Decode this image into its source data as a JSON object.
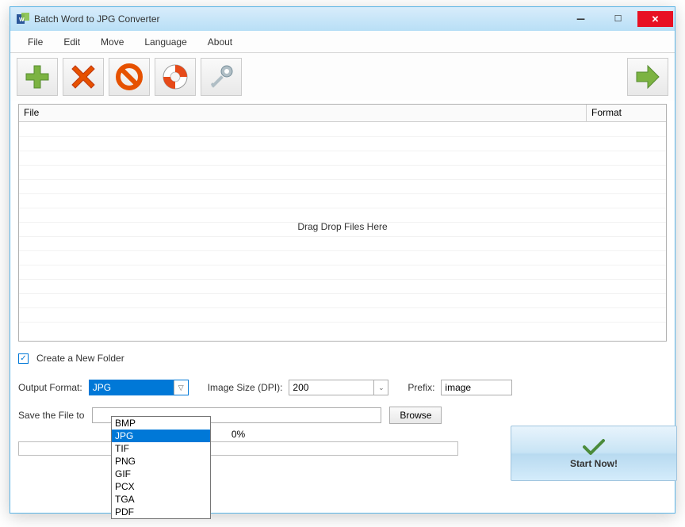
{
  "title": "Batch Word to JPG Converter",
  "menu": {
    "file": "File",
    "edit": "Edit",
    "move": "Move",
    "language": "Language",
    "about": "About"
  },
  "toolbar_icons": {
    "add": "add-icon",
    "remove": "remove-icon",
    "clear": "clear-icon",
    "help": "help-icon",
    "register": "register-icon",
    "convert": "convert-icon"
  },
  "table": {
    "col_file": "File",
    "col_format": "Format",
    "drag_hint": "Drag  Drop Files Here"
  },
  "checkbox_label": "Create a New Folder",
  "checkbox_checked": true,
  "output_format": {
    "label": "Output Format:",
    "value": "JPG",
    "options": [
      "BMP",
      "JPG",
      "TIF",
      "PNG",
      "GIF",
      "PCX",
      "TGA",
      "PDF"
    ],
    "selected_index": 1
  },
  "image_size": {
    "label": "Image Size (DPI):",
    "value": "200"
  },
  "prefix": {
    "label": "Prefix:",
    "value": "image"
  },
  "save": {
    "label": "Save the File to",
    "value": "",
    "browse": "Browse"
  },
  "progress": {
    "percent": "0%"
  },
  "start_button": "Start Now!"
}
